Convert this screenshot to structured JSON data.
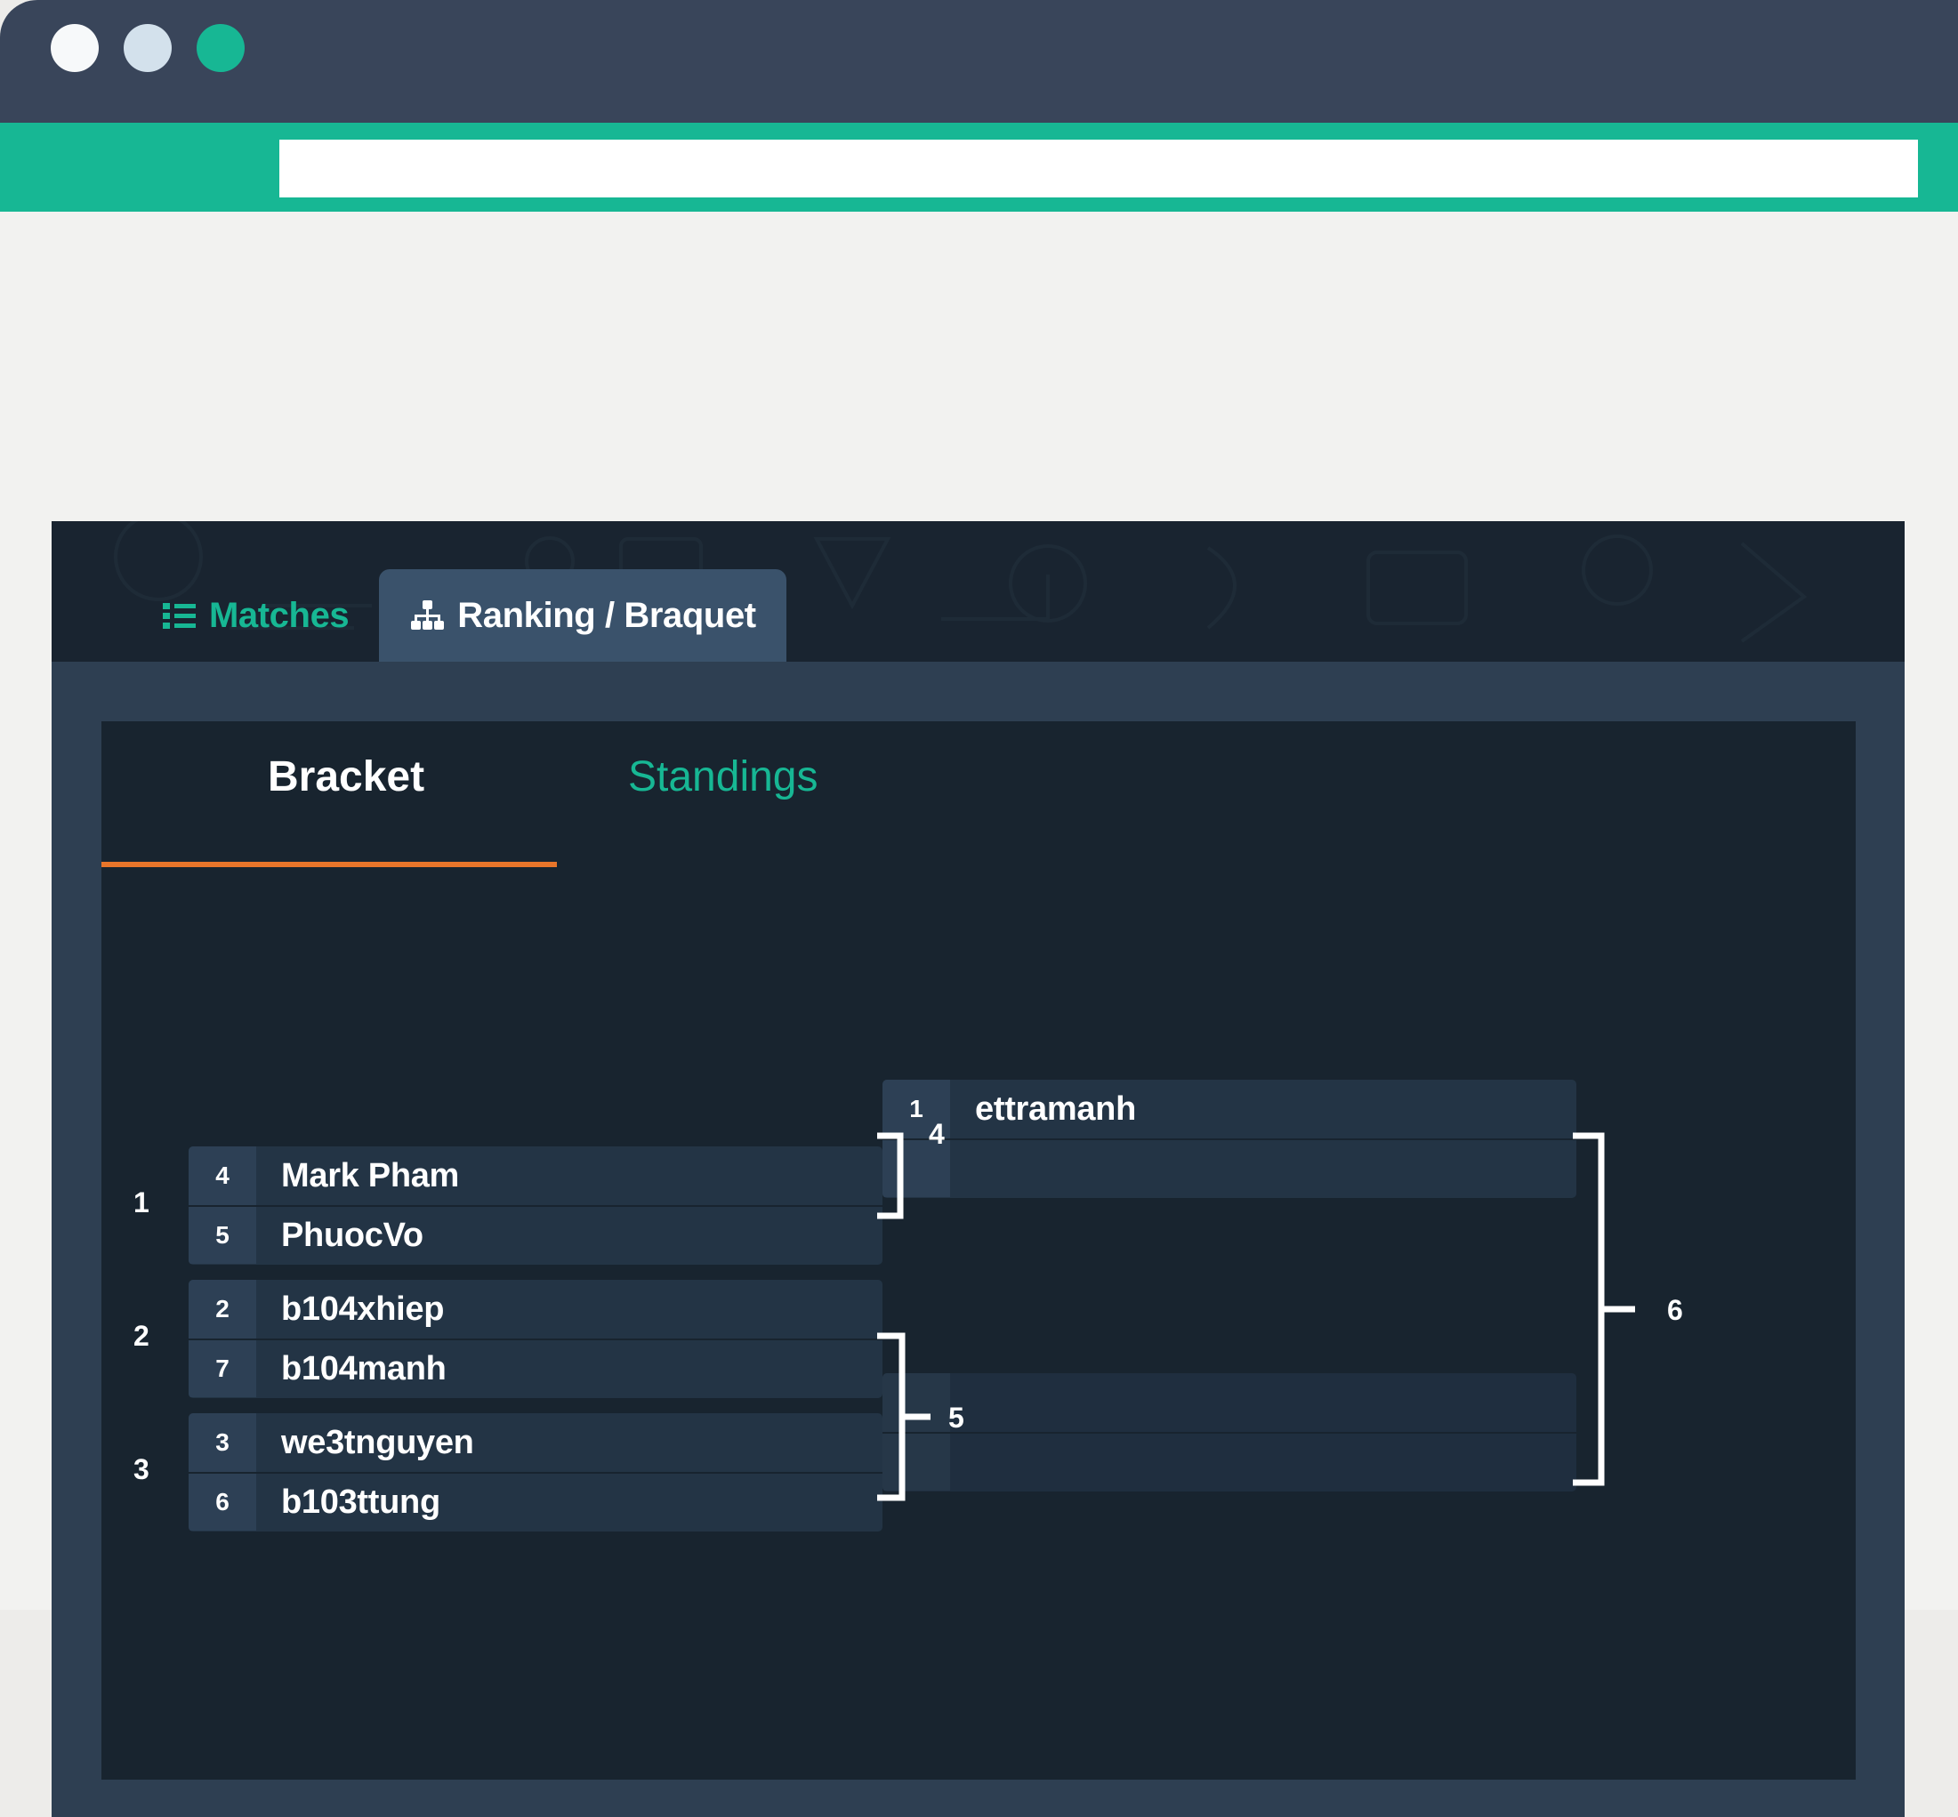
{
  "window": {
    "dots": [
      "close-dot",
      "minimize-dot",
      "maximize-dot"
    ],
    "url_value": "",
    "url_placeholder": ""
  },
  "tabs": [
    {
      "id": "matches",
      "label": "Matches",
      "icon": "list-icon",
      "active": false
    },
    {
      "id": "ranking",
      "label": "Ranking / Braquet",
      "icon": "sitemap-icon",
      "active": true
    }
  ],
  "subtabs": [
    {
      "id": "bracket",
      "label": "Bracket",
      "active": true
    },
    {
      "id": "standings",
      "label": "Standings",
      "active": false
    }
  ],
  "bracket": {
    "rounds": [
      {
        "name": "round-1",
        "matches": [
          {
            "index": "1",
            "slots": [
              {
                "seed": "4",
                "name": "Mark Pham"
              },
              {
                "seed": "5",
                "name": "PhuocVo"
              }
            ]
          },
          {
            "index": "2",
            "slots": [
              {
                "seed": "2",
                "name": "b104xhiep"
              },
              {
                "seed": "7",
                "name": "b104manh"
              }
            ]
          },
          {
            "index": "3",
            "slots": [
              {
                "seed": "3",
                "name": "we3tnguyen"
              },
              {
                "seed": "6",
                "name": "b103ttung"
              }
            ]
          }
        ]
      },
      {
        "name": "round-2",
        "matches": [
          {
            "index": "4",
            "slots": [
              {
                "seed": "1",
                "name": "ettramanh"
              },
              {
                "seed": "",
                "name": ""
              }
            ]
          },
          {
            "index": "5",
            "slots": [
              {
                "seed": "",
                "name": ""
              },
              {
                "seed": "",
                "name": ""
              }
            ]
          }
        ]
      }
    ],
    "connectors": [
      {
        "id": "connector-4",
        "label": "4"
      },
      {
        "id": "connector-5",
        "label": "5"
      },
      {
        "id": "connector-6",
        "label": "6"
      }
    ]
  },
  "colors": {
    "accent_teal": "#17b794",
    "accent_orange": "#e8752a",
    "panel_bg": "#2e3f52",
    "card_bg": "#18242f",
    "tabstrip_bg": "#192430",
    "match_bg": "#233445",
    "seed_bg": "#2d4055",
    "titlebar_bg": "#39455a"
  }
}
